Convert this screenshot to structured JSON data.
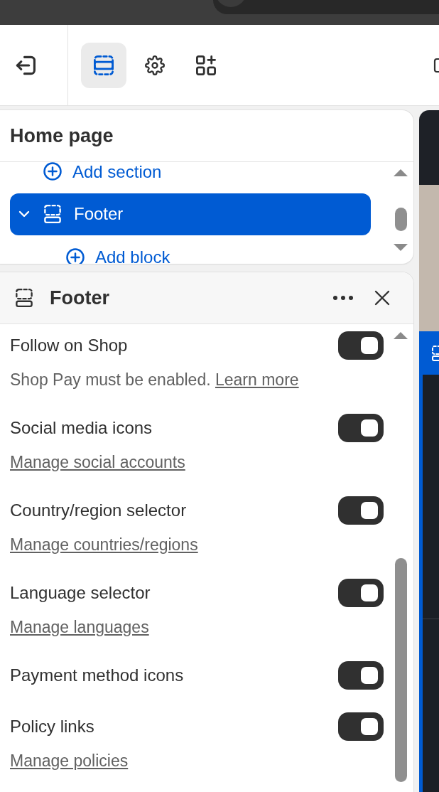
{
  "toolbar": {
    "tabs": [
      {
        "kind": "sections",
        "selected": true
      },
      {
        "kind": "settings",
        "selected": false
      },
      {
        "kind": "apps",
        "selected": false
      }
    ]
  },
  "sections_panel": {
    "title": "Home page",
    "tree": [
      {
        "kind": "add",
        "label": "Add section",
        "selected": false
      },
      {
        "kind": "section",
        "label": "Footer",
        "selected": true,
        "expanded": true,
        "children": [
          {
            "kind": "add",
            "label": "Add block",
            "selected": false
          }
        ]
      }
    ]
  },
  "settings_panel": {
    "title": "Footer",
    "settings": [
      {
        "label": "Follow on Shop",
        "on": true,
        "help": "Shop Pay must be enabled.",
        "link": "Learn more"
      },
      {
        "label": "Social media icons",
        "on": true,
        "link": "Manage social accounts"
      },
      {
        "label": "Country/region selector",
        "on": true,
        "link": "Manage countries/regions"
      },
      {
        "label": "Language selector",
        "on": true,
        "link": "Manage languages"
      },
      {
        "label": "Payment method icons",
        "on": true
      },
      {
        "label": "Policy links",
        "on": true,
        "link": "Manage policies"
      }
    ]
  }
}
